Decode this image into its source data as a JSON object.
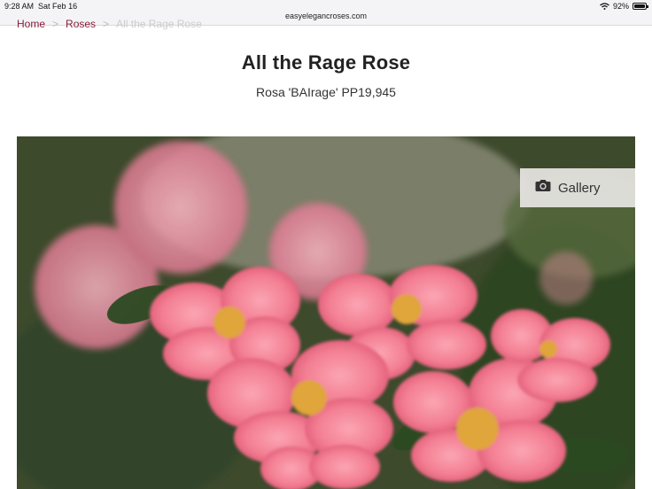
{
  "status_bar": {
    "time": "9:28 AM",
    "date": "Sat Feb 16",
    "url": "easyelegancroses.com",
    "battery": "92%"
  },
  "breadcrumb": {
    "items": [
      "Home",
      "Roses",
      "All the Rage Rose"
    ],
    "separator": ">"
  },
  "product": {
    "title": "All the Rage Rose",
    "subtitle": "Rosa 'BAIrage' PP19,945"
  },
  "gallery": {
    "label": "Gallery",
    "icon": "camera-icon"
  },
  "colors": {
    "brand": "#8a1f3b",
    "rose_pink": "#f07a8f",
    "rose_center": "#e0a53a"
  }
}
